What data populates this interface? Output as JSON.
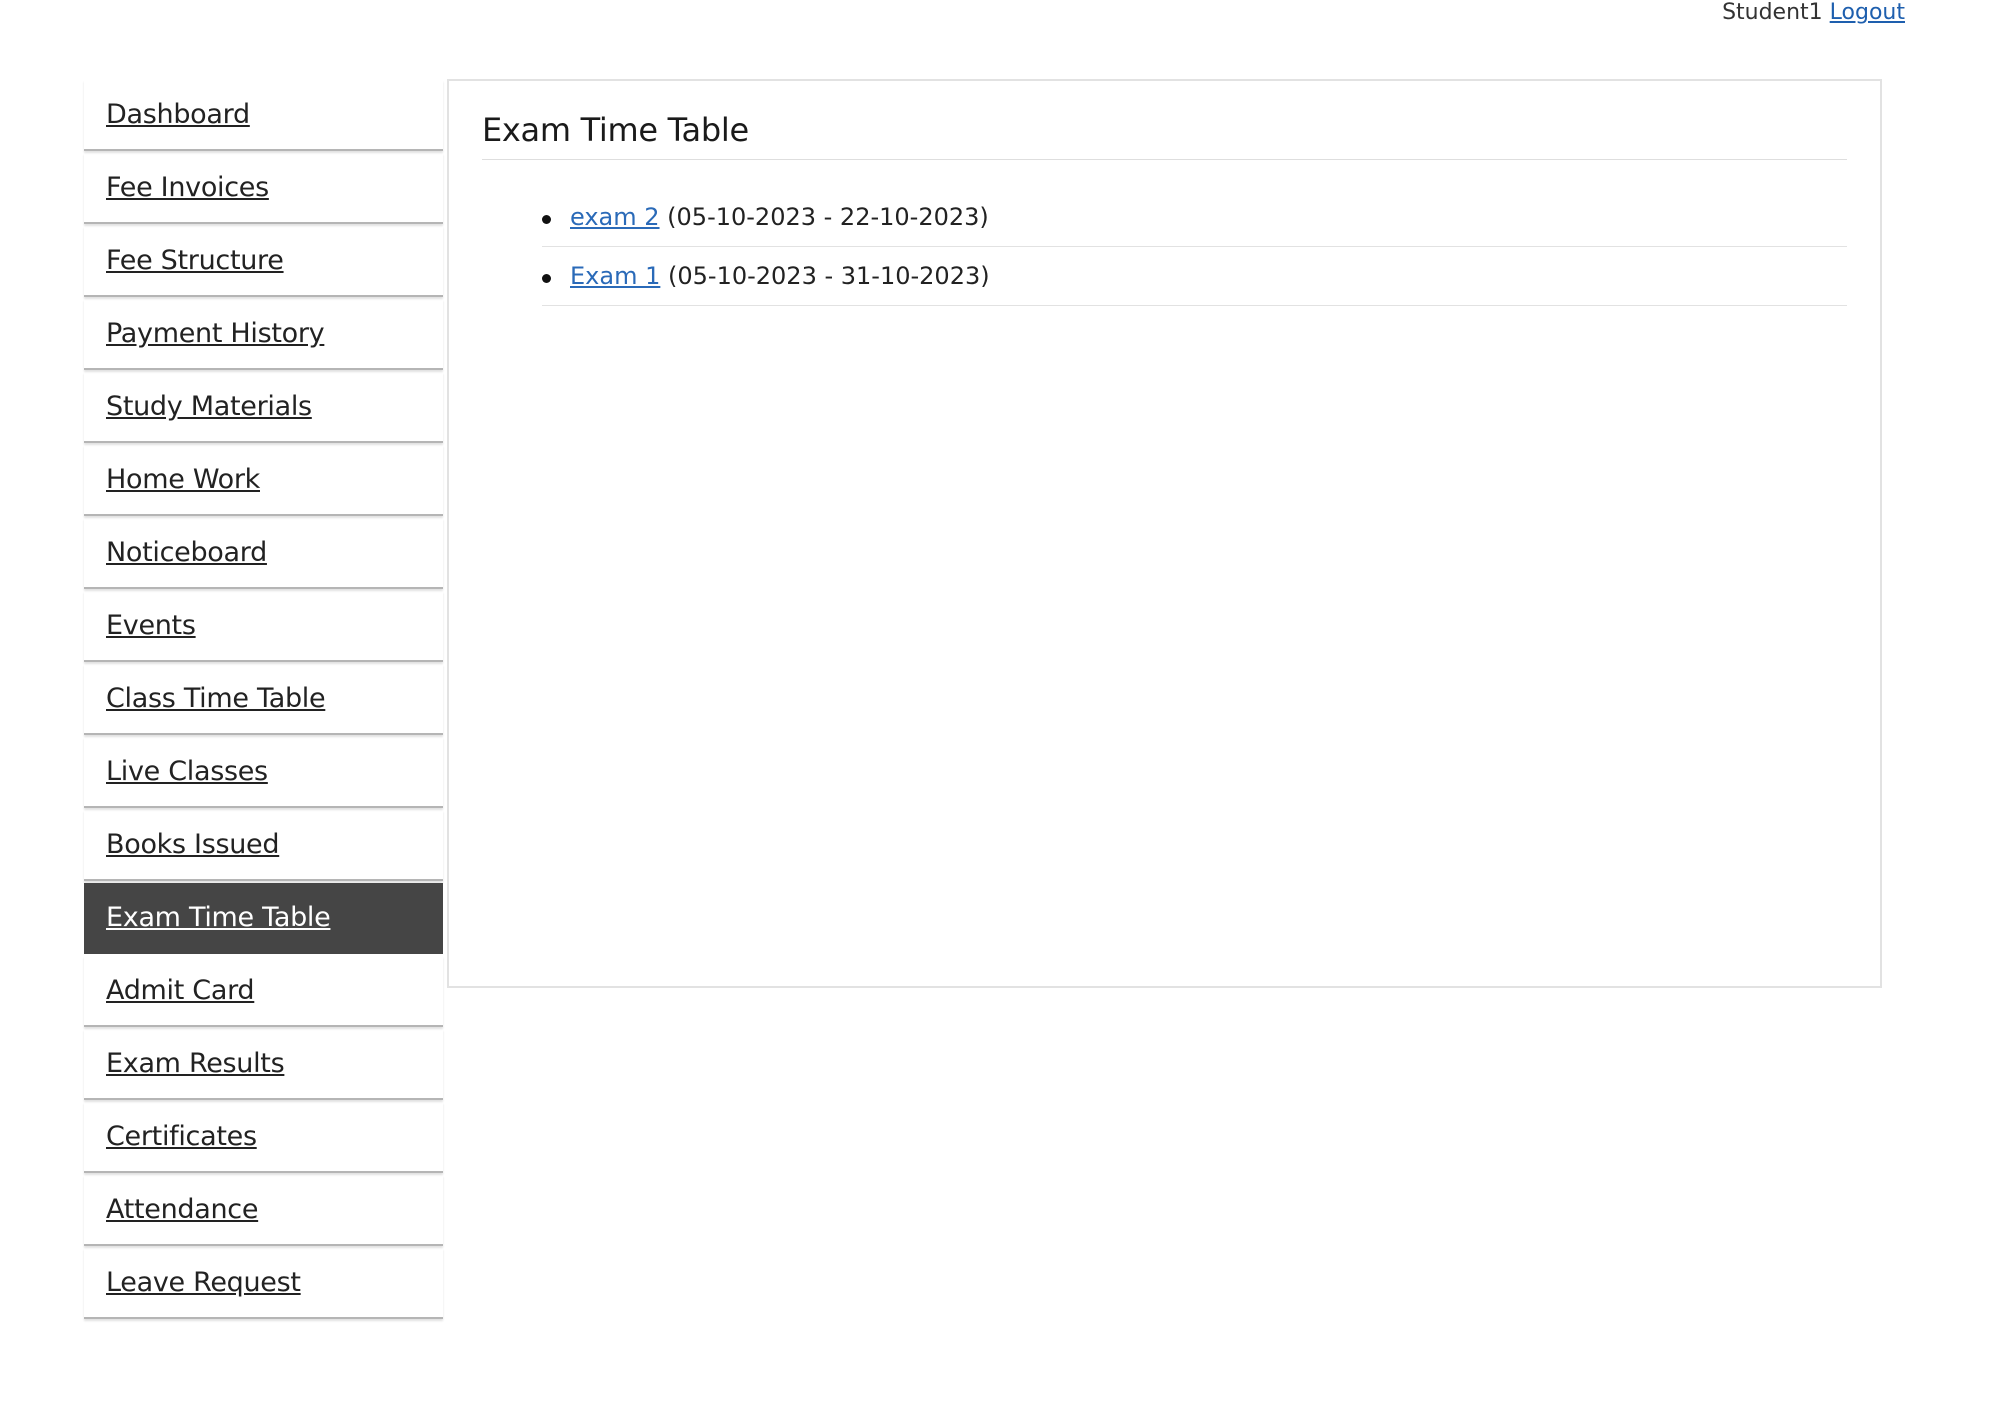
{
  "header": {
    "username": "Student1",
    "logout_label": "Logout"
  },
  "sidebar": {
    "items": [
      {
        "label": "Dashboard",
        "active": false
      },
      {
        "label": "Fee Invoices",
        "active": false
      },
      {
        "label": "Fee Structure",
        "active": false
      },
      {
        "label": "Payment History",
        "active": false
      },
      {
        "label": "Study Materials",
        "active": false
      },
      {
        "label": "Home Work",
        "active": false
      },
      {
        "label": "Noticeboard",
        "active": false
      },
      {
        "label": "Events",
        "active": false
      },
      {
        "label": "Class Time Table",
        "active": false
      },
      {
        "label": "Live Classes",
        "active": false
      },
      {
        "label": "Books Issued",
        "active": false
      },
      {
        "label": "Exam Time Table",
        "active": true
      },
      {
        "label": "Admit Card",
        "active": false
      },
      {
        "label": "Exam Results",
        "active": false
      },
      {
        "label": "Certificates",
        "active": false
      },
      {
        "label": "Attendance",
        "active": false
      },
      {
        "label": "Leave Request",
        "active": false
      }
    ]
  },
  "main": {
    "title": "Exam Time Table",
    "exams": [
      {
        "name": "exam 2",
        "dates": "(05-10-2023 - 22-10-2023)"
      },
      {
        "name": "Exam 1",
        "dates": "(05-10-2023 - 31-10-2023)"
      }
    ]
  },
  "colors": {
    "active_nav_bg": "#454545",
    "link": "#2a6ab8"
  }
}
